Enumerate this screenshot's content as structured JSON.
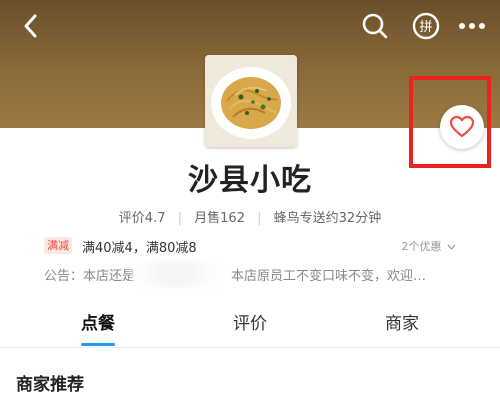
{
  "header": {
    "back_icon": "back-arrow-icon",
    "search_icon": "search-icon",
    "pin_icon": "group-order-icon",
    "pin_label": "拼",
    "more_icon": "more-icon"
  },
  "shop": {
    "name": "沙县小吃",
    "rating": "评价4.7",
    "monthly_sales": "月售162",
    "delivery": "蜂鸟专送约32分钟"
  },
  "promo": {
    "tag": "满减",
    "text": "满40减4，满80减8",
    "count": "2个优惠"
  },
  "notice": {
    "left": "公告：本店还是",
    "right": "本店原员工不变口味不变，欢迎…"
  },
  "tabs": [
    {
      "label": "点餐",
      "active": true
    },
    {
      "label": "评价",
      "active": false
    },
    {
      "label": "商家",
      "active": false
    }
  ],
  "section": {
    "title": "商家推荐"
  },
  "colors": {
    "accent": "#2196f3",
    "highlight_box": "#e8241f",
    "favorite_heart": "#e8503a",
    "promo_tag": "#e8503a"
  }
}
